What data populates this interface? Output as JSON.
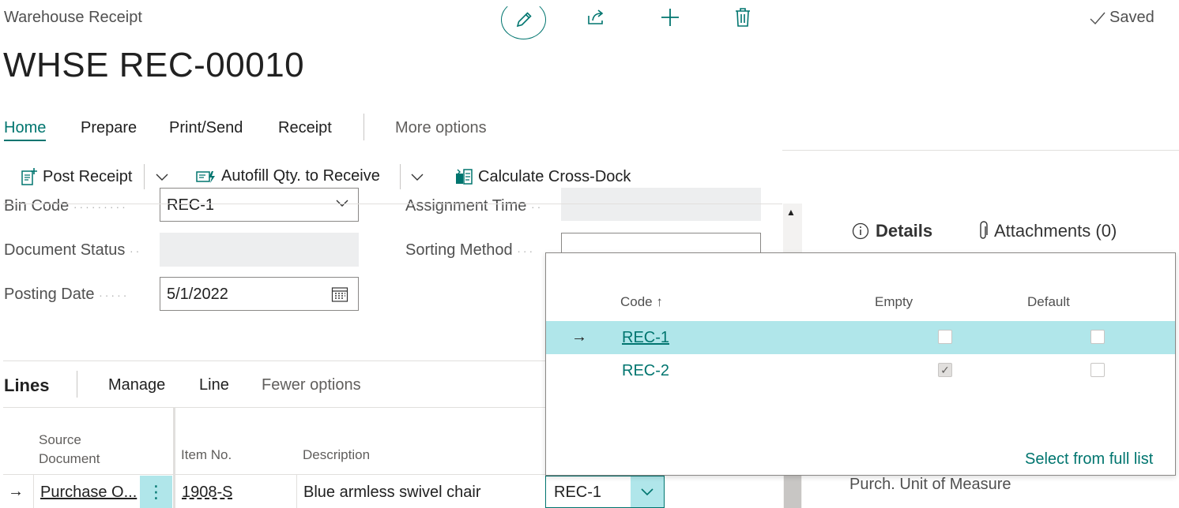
{
  "header": {
    "caption": "Warehouse Receipt",
    "title": "WHSE REC-00010",
    "saved_label": "Saved"
  },
  "icons": {
    "edit": "edit-pencil-icon",
    "share": "share-icon",
    "new": "plus-icon",
    "delete": "trash-icon",
    "saved": "checkmark-icon"
  },
  "tabs": [
    {
      "label": "Home"
    },
    {
      "label": "Prepare"
    },
    {
      "label": "Print/Send"
    },
    {
      "label": "Receipt"
    },
    {
      "label": "More options"
    }
  ],
  "actions": {
    "post_receipt": "Post Receipt",
    "autofill": "Autofill Qty. to Receive",
    "cross_dock": "Calculate Cross-Dock"
  },
  "form": {
    "bin_code_label": "Bin Code",
    "bin_code_value": "REC-1",
    "assignment_time_label": "Assignment Time",
    "document_status_label": "Document Status",
    "sorting_method_label": "Sorting Method",
    "posting_date_label": "Posting Date",
    "posting_date_value": "5/1/2022"
  },
  "lines": {
    "title": "Lines",
    "manage": "Manage",
    "line": "Line",
    "fewer": "Fewer options",
    "col_source_1": "Source",
    "col_source_2": "Document",
    "col_item": "Item No.",
    "col_desc": "Description",
    "row": {
      "source": "Purchase O...",
      "item": "1908-S",
      "description": "Blue armless swivel chair",
      "bin": "REC-1"
    }
  },
  "factbox": {
    "details": "Details",
    "attachments": "Attachments (0)",
    "purch_uom": "Purch. Unit of Measure"
  },
  "dropdown": {
    "col_code": "Code",
    "col_empty": "Empty",
    "col_default": "Default",
    "rows": [
      {
        "code": "REC-1",
        "empty": false,
        "default": false
      },
      {
        "code": "REC-2",
        "empty": true,
        "default": false
      }
    ],
    "select_full": "Select from full list"
  },
  "colors": {
    "accent": "#00756f",
    "selected_row": "#b0e6ea"
  }
}
